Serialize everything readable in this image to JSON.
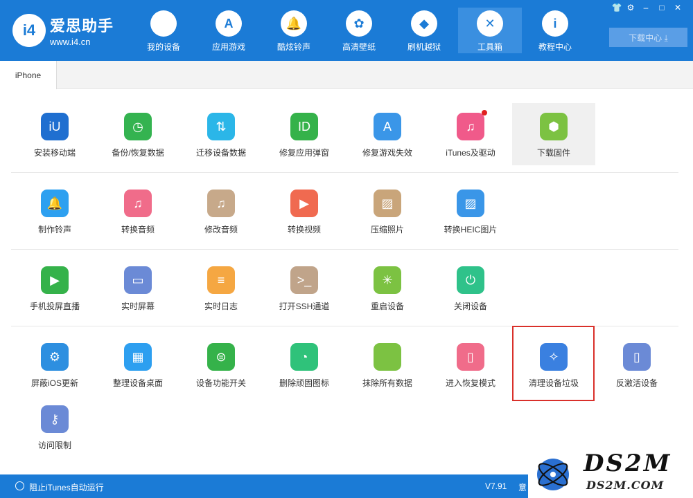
{
  "header": {
    "logo_mark": "i4",
    "logo_name": "爱思助手",
    "logo_url": "www.i4.cn",
    "nav": [
      {
        "label": "我的设备",
        "icon": "apple-icon",
        "glyph": ""
      },
      {
        "label": "应用游戏",
        "icon": "app-store-icon",
        "glyph": "A"
      },
      {
        "label": "酷炫铃声",
        "icon": "bell-icon",
        "glyph": "🔔"
      },
      {
        "label": "高清壁纸",
        "icon": "flower-icon",
        "glyph": "✿"
      },
      {
        "label": "刷机越狱",
        "icon": "dropbox-icon",
        "glyph": "◆"
      },
      {
        "label": "工具箱",
        "icon": "tools-icon",
        "glyph": "✕"
      },
      {
        "label": "教程中心",
        "icon": "info-icon",
        "glyph": "i"
      }
    ],
    "active_nav": "工具箱",
    "download_center": "下载中心 ⤓",
    "window_buttons": [
      "👕",
      "⚙",
      "–",
      "□",
      "✕"
    ]
  },
  "tabs": {
    "device": "iPhone"
  },
  "tools": [
    [
      {
        "label": "安装移动端",
        "icon": "i4-app-icon",
        "color": "#1f6fd0",
        "glyph": "iU"
      },
      {
        "label": "备份/恢复数据",
        "icon": "backup-clock-icon",
        "color": "#34b350",
        "glyph": "◷"
      },
      {
        "label": "迁移设备数据",
        "icon": "phone-transfer-icon",
        "color": "#2bb6e8",
        "glyph": "⇅"
      },
      {
        "label": "修复应用弹窗",
        "icon": "apple-id-icon",
        "color": "#35b24a",
        "glyph": "ID"
      },
      {
        "label": "修复游戏失效",
        "icon": "app-store-icon",
        "color": "#3a96e8",
        "glyph": "A"
      },
      {
        "label": "iTunes及驱动",
        "icon": "itunes-icon",
        "color": "#f05a8a",
        "glyph": "♫"
      },
      {
        "label": "下载固件",
        "icon": "firmware-box-icon",
        "color": "#7cc242",
        "glyph": "⬢"
      }
    ],
    [
      {
        "label": "制作铃声",
        "icon": "bell-add-icon",
        "color": "#2da0f0",
        "glyph": "🔔"
      },
      {
        "label": "转换音频",
        "icon": "music-convert-icon",
        "color": "#f06c8a",
        "glyph": "♫"
      },
      {
        "label": "修改音频",
        "icon": "music-edit-icon",
        "color": "#c7a98a",
        "glyph": "♫"
      },
      {
        "label": "转换视频",
        "icon": "video-convert-icon",
        "color": "#f06a50",
        "glyph": "▶"
      },
      {
        "label": "压缩照片",
        "icon": "photo-compress-icon",
        "color": "#c9a57a",
        "glyph": "▨"
      },
      {
        "label": "转换HEIC图片",
        "icon": "heic-convert-icon",
        "color": "#3a96e8",
        "glyph": "▨"
      }
    ],
    [
      {
        "label": "手机投屏直播",
        "icon": "screen-cast-icon",
        "color": "#35b24a",
        "glyph": "▶"
      },
      {
        "label": "实时屏幕",
        "icon": "monitor-icon",
        "color": "#6b8ad6",
        "glyph": "▭"
      },
      {
        "label": "实时日志",
        "icon": "log-icon",
        "color": "#f5a742",
        "glyph": "≡"
      },
      {
        "label": "打开SSH通道",
        "icon": "terminal-icon",
        "color": "#c0a48a",
        "glyph": ">_"
      },
      {
        "label": "重启设备",
        "icon": "restart-icon",
        "color": "#7cc242",
        "glyph": "✳"
      },
      {
        "label": "关闭设备",
        "icon": "power-icon",
        "color": "#2fc28a",
        "glyph": "⏻"
      }
    ],
    [
      {
        "label": "屏蔽iOS更新",
        "icon": "block-update-icon",
        "color": "#2d8fe0",
        "glyph": "⚙"
      },
      {
        "label": "整理设备桌面",
        "icon": "grid-icon",
        "color": "#2d9ff0",
        "glyph": "▦"
      },
      {
        "label": "设备功能开关",
        "icon": "toggle-switch-icon",
        "color": "#35b24a",
        "glyph": "⊜"
      },
      {
        "label": "删除顽固图标",
        "icon": "pie-icon",
        "color": "#2fc27a",
        "glyph": "◔"
      },
      {
        "label": "抹除所有数据",
        "icon": "erase-apple-icon",
        "color": "#7cc242",
        "glyph": ""
      },
      {
        "label": "进入恢复模式",
        "icon": "recovery-mode-icon",
        "color": "#f06c8a",
        "glyph": "▯"
      },
      {
        "label": "清理设备垃圾",
        "icon": "broom-icon",
        "color": "#3a80e0",
        "glyph": "✧"
      },
      {
        "label": "反激活设备",
        "icon": "deactivate-icon",
        "color": "#6b8ad6",
        "glyph": "▯"
      }
    ],
    [
      {
        "label": "访问限制",
        "icon": "key-icon",
        "color": "#6b8ad6",
        "glyph": "⚷"
      }
    ]
  ],
  "footer": {
    "itunes_label": "阻止iTunes自动运行",
    "version": "V7.91",
    "extra": "意"
  },
  "watermark": {
    "name": "DS2M",
    "url": "DS2M.COM"
  }
}
